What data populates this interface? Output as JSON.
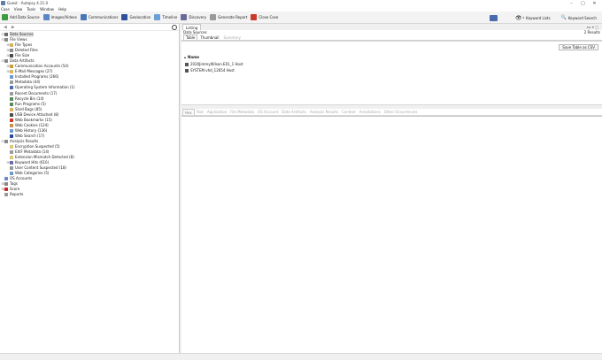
{
  "window": {
    "title": "Guest - Autopsy 4.21.0",
    "controls": [
      "–",
      "▢",
      "✕"
    ]
  },
  "menu": [
    "Case",
    "View",
    "Tools",
    "Window",
    "Help"
  ],
  "toolbar": {
    "buttons": [
      {
        "label": "Add Data Source",
        "icon": "add-icon",
        "color": "#3a9c3a"
      },
      {
        "label": "Images/Videos",
        "icon": "images-icon",
        "color": "#5a86c8"
      },
      {
        "label": "Communications",
        "icon": "communications-icon",
        "color": "#4a76b8"
      },
      {
        "label": "Geolocation",
        "icon": "geolocation-icon",
        "color": "#2f4f9c"
      },
      {
        "label": "Timeline",
        "icon": "timeline-icon",
        "color": "#6aa0d8"
      },
      {
        "label": "Discovery",
        "icon": "discovery-icon",
        "color": "#6a6a9a"
      },
      {
        "label": "Generate Report",
        "icon": "report-icon",
        "color": "#9a9a9a"
      },
      {
        "label": "Close Case",
        "icon": "close-case-icon",
        "color": "#c83a2a"
      }
    ],
    "keyword_lists": "Keyword Lists",
    "keyword_search": "Keyword Search"
  },
  "tree": [
    {
      "label": "Data Sources",
      "level": 0,
      "exp": "⊟",
      "icon": "database-icon",
      "color": "#6a6a6a",
      "selected": true
    },
    {
      "label": "File Views",
      "level": 0,
      "exp": "⊟",
      "icon": "file-views-icon",
      "color": "#8a8a8a"
    },
    {
      "label": "File Types",
      "level": 1,
      "exp": "⊞",
      "icon": "folder-icon",
      "color": "#d8b25a"
    },
    {
      "label": "Deleted Files",
      "level": 1,
      "exp": "⊞",
      "icon": "deleted-files-icon",
      "color": "#8a8a8a"
    },
    {
      "label": "File Size",
      "level": 1,
      "exp": "⊞",
      "icon": "file-size-icon",
      "color": "#4a4a4a"
    },
    {
      "label": "Data Artifacts",
      "level": 0,
      "exp": "⊟",
      "icon": "artifacts-icon",
      "color": "#8a8a8a"
    },
    {
      "label": "Communication Accounts (54)",
      "level": 1,
      "exp": "⊞",
      "icon": "account-icon",
      "color": "#c8a038"
    },
    {
      "label": "E-Mail Messages (27)",
      "level": 1,
      "exp": "⊞",
      "icon": "email-icon",
      "color": "#d8b860"
    },
    {
      "label": "Installed Programs (266)",
      "level": 1,
      "exp": "",
      "icon": "programs-icon",
      "color": "#6a9ad0"
    },
    {
      "label": "Metadata (44)",
      "level": 1,
      "exp": "",
      "icon": "metadata-icon",
      "color": "#9a9a9a"
    },
    {
      "label": "Operating System Information (1)",
      "level": 1,
      "exp": "",
      "icon": "os-icon",
      "color": "#4a6ab0"
    },
    {
      "label": "Recent Documents (17)",
      "level": 1,
      "exp": "",
      "icon": "recent-docs-icon",
      "color": "#9a9a9a"
    },
    {
      "label": "Recycle Bin (14)",
      "level": 1,
      "exp": "",
      "icon": "recycle-bin-icon",
      "color": "#5a8a5a"
    },
    {
      "label": "Run Programs (5)",
      "level": 1,
      "exp": "",
      "icon": "run-programs-icon",
      "color": "#5a8a5a"
    },
    {
      "label": "Shell Bags (85)",
      "level": 1,
      "exp": "",
      "icon": "shell-bags-icon",
      "color": "#d8b25a"
    },
    {
      "label": "USB Device Attached (8)",
      "level": 1,
      "exp": "",
      "icon": "usb-icon",
      "color": "#4a4a4a"
    },
    {
      "label": "Web Bookmarks (15)",
      "level": 1,
      "exp": "",
      "icon": "bookmark-icon",
      "color": "#c83a2a"
    },
    {
      "label": "Web Cookies (124)",
      "level": 1,
      "exp": "",
      "icon": "cookie-icon",
      "color": "#c89048"
    },
    {
      "label": "Web History (136)",
      "level": 1,
      "exp": "",
      "icon": "web-history-icon",
      "color": "#6a9ad0"
    },
    {
      "label": "Web Search (17)",
      "level": 1,
      "exp": "",
      "icon": "web-search-icon",
      "color": "#2a4a9a"
    },
    {
      "label": "Analysis Results",
      "level": 0,
      "exp": "⊟",
      "icon": "analysis-icon",
      "color": "#8a8a8a"
    },
    {
      "label": "Encryption Suspected (5)",
      "level": 1,
      "exp": "",
      "icon": "encryption-icon",
      "color": "#d8c878"
    },
    {
      "label": "EXIF Metadata (14)",
      "level": 1,
      "exp": "",
      "icon": "exif-icon",
      "color": "#9a9a9a"
    },
    {
      "label": "Extension Mismatch Detected (8)",
      "level": 1,
      "exp": "",
      "icon": "mismatch-icon",
      "color": "#d8c878"
    },
    {
      "label": "Keyword Hits (610)",
      "level": 1,
      "exp": "⊞",
      "icon": "keyword-icon",
      "color": "#6a6ab0"
    },
    {
      "label": "User Content Suspected (18)",
      "level": 1,
      "exp": "",
      "icon": "user-content-icon",
      "color": "#9a9a9a"
    },
    {
      "label": "Web Categories (5)",
      "level": 1,
      "exp": "",
      "icon": "web-categories-icon",
      "color": "#6a9ad0"
    },
    {
      "label": "OS Accounts",
      "level": 0,
      "exp": "",
      "icon": "os-accounts-icon",
      "color": "#6a8ac8"
    },
    {
      "label": "Tags",
      "level": 0,
      "exp": "⊞",
      "icon": "tags-icon",
      "color": "#8a8a8a"
    },
    {
      "label": "Score",
      "level": 0,
      "exp": "⊞",
      "icon": "score-icon",
      "color": "#c82a2a"
    },
    {
      "label": "Reports",
      "level": 0,
      "exp": "",
      "icon": "reports-icon",
      "color": "#9a9a9a"
    }
  ],
  "listing": {
    "tab": "Listing",
    "breadcrumb": "Data Sources",
    "results_count": "2  Results",
    "subtabs": [
      {
        "label": "Table",
        "state": "active"
      },
      {
        "label": "Thumbnail",
        "state": "normal"
      },
      {
        "label": "Summary",
        "state": "disabled"
      }
    ],
    "save_button": "Save Table as CSV",
    "column": "Name",
    "rows": [
      "2020JimmyWilson.E01_1 Host",
      "SYSTEM.vhd_12654 Host"
    ]
  },
  "content_tabs": [
    "Hex",
    "Text",
    "Application",
    "File Metadata",
    "OS Account",
    "Data Artifacts",
    "Analysis Results",
    "Context",
    "Annotations",
    "Other Occurrences"
  ]
}
